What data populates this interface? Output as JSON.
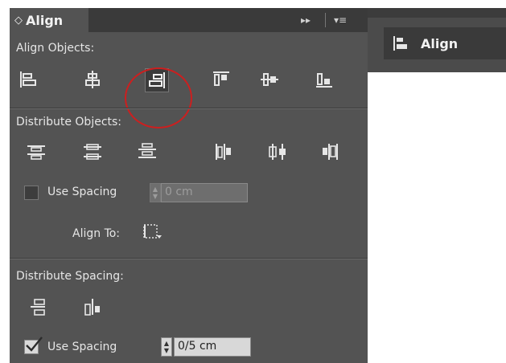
{
  "panel": {
    "title": "Align",
    "controls": {
      "forward": "▸▸",
      "menu": "▾≡"
    }
  },
  "align_objects": {
    "label": "Align Objects:",
    "buttons": [
      {
        "name": "align-left-edges-icon"
      },
      {
        "name": "align-horizontal-centers-icon"
      },
      {
        "name": "align-right-edges-icon",
        "active": true
      },
      {
        "name": "align-top-edges-icon"
      },
      {
        "name": "align-vertical-centers-icon"
      },
      {
        "name": "align-bottom-edges-icon"
      }
    ]
  },
  "distribute_objects": {
    "label": "Distribute Objects:",
    "use_spacing_label": "Use Spacing",
    "use_spacing_checked": false,
    "spacing_value": "0 cm"
  },
  "align_to": {
    "label": "Align To:"
  },
  "distribute_spacing": {
    "label": "Distribute Spacing:",
    "use_spacing_label": "Use Spacing",
    "use_spacing_checked": true,
    "spacing_value": "0/5 cm"
  },
  "dock": {
    "label": "Align"
  },
  "colors": {
    "panel_bg": "#535353",
    "header_bg": "#3a3a3a",
    "highlight_circle": "#cc1f1f"
  }
}
